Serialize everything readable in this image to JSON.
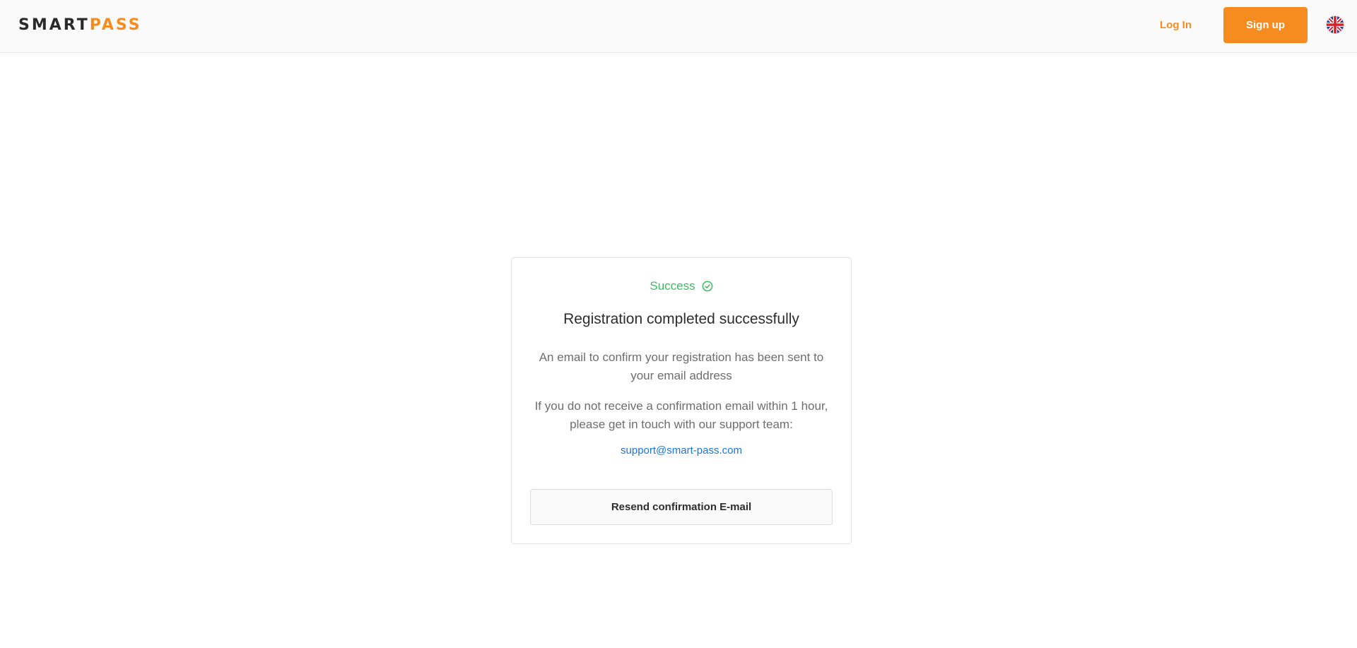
{
  "header": {
    "logo_part_a": "SMART",
    "logo_part_b": "PASS",
    "login_label": "Log In",
    "signup_label": "Sign up",
    "language_icon": "uk-flag-icon"
  },
  "card": {
    "status_label": "Success",
    "status_icon": "check-circle-icon",
    "title": "Registration completed successfully",
    "description_1": "An email to confirm your registration has been sent to your email address",
    "description_2": "If you do not receive a confirmation email within 1 hour, please get in touch with our support team:",
    "support_email": "support@smart-pass.com",
    "resend_label": "Resend confirmation E-mail"
  },
  "colors": {
    "brand_orange": "#f68b1f",
    "success_green": "#3dbb61",
    "link_blue": "#1a73e8"
  }
}
